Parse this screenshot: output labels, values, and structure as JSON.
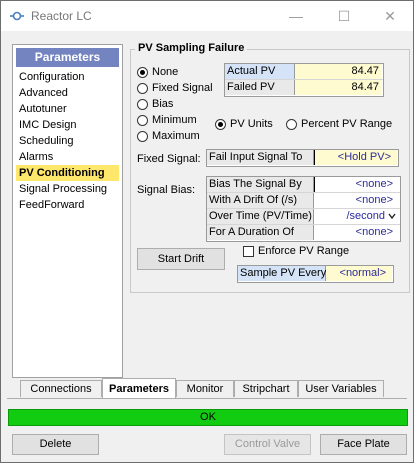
{
  "window": {
    "title": "Reactor LC",
    "minimize": "—",
    "maximize": "☐",
    "close": "✕"
  },
  "nav": {
    "header": "Parameters",
    "items": [
      {
        "label": "Configuration"
      },
      {
        "label": "Advanced"
      },
      {
        "label": "Autotuner"
      },
      {
        "label": "IMC Design"
      },
      {
        "label": "Scheduling"
      },
      {
        "label": "Alarms"
      },
      {
        "label": "PV Conditioning",
        "selected": true
      },
      {
        "label": "Signal Processing"
      },
      {
        "label": "FeedForward"
      }
    ]
  },
  "group": {
    "title": "PV Sampling Failure"
  },
  "failure_modes": [
    {
      "label": "None",
      "checked": true
    },
    {
      "label": "Fixed Signal",
      "checked": false
    },
    {
      "label": "Bias",
      "checked": false
    },
    {
      "label": "Minimum",
      "checked": false
    },
    {
      "label": "Maximum",
      "checked": false
    }
  ],
  "pv_readout": [
    {
      "label": "Actual PV",
      "value": "84.47"
    },
    {
      "label": "Failed PV",
      "value": "84.47"
    }
  ],
  "units": [
    {
      "label": "PV Units",
      "checked": true
    },
    {
      "label": "Percent PV Range",
      "checked": false
    }
  ],
  "fixed_signal": {
    "label": "Fixed Signal:",
    "field_label": "Fail Input Signal To",
    "value": "<Hold PV>"
  },
  "signal_bias": {
    "label": "Signal Bias:",
    "rows": [
      {
        "label": "Bias The Signal By",
        "value": "<none>"
      },
      {
        "label": "With A Drift Of (/s)",
        "value": "<none>"
      },
      {
        "label": "Over Time (PV/Time)",
        "value": "/second"
      },
      {
        "label": "For A Duration Of",
        "value": "<none>"
      }
    ]
  },
  "start_drift": {
    "label": "Start Drift"
  },
  "enforce": {
    "label": "Enforce PV Range",
    "checked": false
  },
  "sample": {
    "label": "Sample PV Every",
    "value": "<normal>"
  },
  "tabs": [
    {
      "label": "Connections"
    },
    {
      "label": "Parameters",
      "active": true
    },
    {
      "label": "Monitor"
    },
    {
      "label": "Stripchart"
    },
    {
      "label": "User Variables"
    }
  ],
  "status": {
    "text": "OK",
    "color": "#12cc12"
  },
  "footer": {
    "delete": "Delete",
    "control_valve": "Control Valve",
    "face_plate": "Face Plate"
  }
}
